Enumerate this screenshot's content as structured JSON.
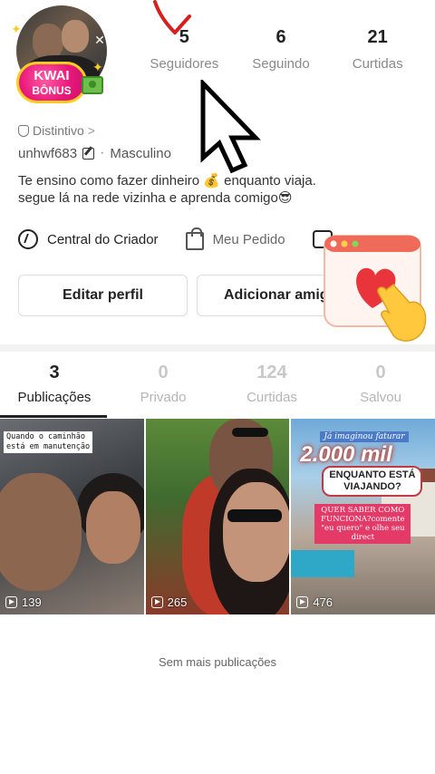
{
  "profile": {
    "kwai_badge_line1": "KWAI",
    "kwai_badge_line2": "BÔNUS",
    "distintivo_label": "Distintivo",
    "distintivo_chevron": ">",
    "username": "unhwf683",
    "gender": "Masculino",
    "bio_line1": "Te ensino como fazer dinheiro 💰 enquanto viaja.",
    "bio_line2": "segue lá na rede vizinha e aprenda comigo😎"
  },
  "stats": [
    {
      "value": "5",
      "label": "Seguidores"
    },
    {
      "value": "6",
      "label": "Seguindo"
    },
    {
      "value": "21",
      "label": "Curtidas"
    }
  ],
  "creator_row": {
    "central": "Central do Criador",
    "pedido": "Meu Pedido",
    "game": "Game"
  },
  "buttons": {
    "edit": "Editar perfil",
    "add_friends": "Adicionar amigos"
  },
  "tabs": [
    {
      "count": "3",
      "label": "Publicações"
    },
    {
      "count": "0",
      "label": "Privado"
    },
    {
      "count": "124",
      "label": "Curtidas"
    },
    {
      "count": "0",
      "label": "Salvou"
    }
  ],
  "posts": [
    {
      "plays": "139",
      "caption_line1": "Quando o caminhão",
      "caption_line2": "está em manutenção"
    },
    {
      "plays": "265"
    },
    {
      "plays": "476",
      "text1": "Já imaginou faturar",
      "text2": "2.000 mil",
      "text3_line1": "ENQUANTO ESTÁ",
      "text3_line2": "VIAJANDO?",
      "text4": "QUER SABER COMO FUNCIONA?comente \"eu quero\" e olhe seu direct"
    }
  ],
  "footer": {
    "no_more": "Sem mais publicações"
  },
  "colors": {
    "kwai_pink": "#e8197a",
    "arrow_red": "#d62020"
  }
}
